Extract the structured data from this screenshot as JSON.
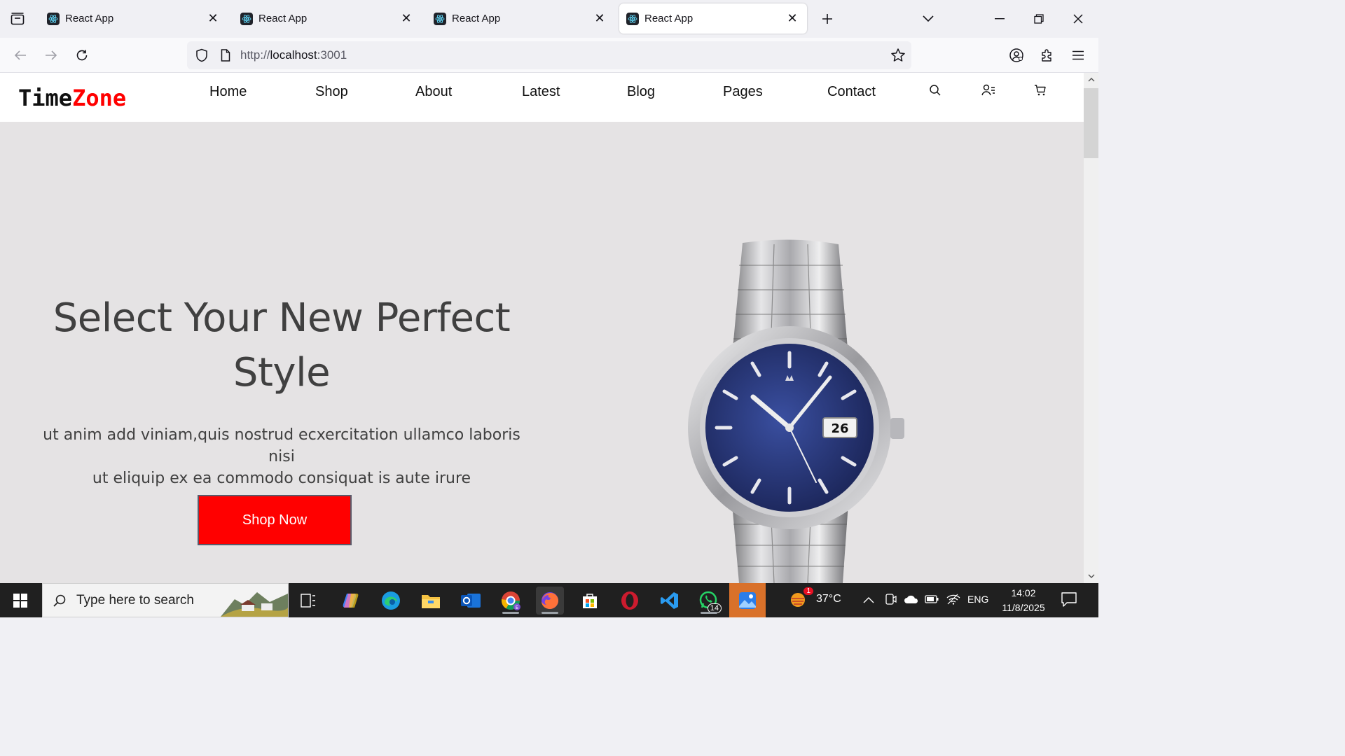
{
  "browser": {
    "tabs": [
      {
        "title": "React App",
        "active": false
      },
      {
        "title": "React App",
        "active": false
      },
      {
        "title": "React App",
        "active": false
      },
      {
        "title": "React App",
        "active": true
      }
    ],
    "url_prefix": "http://",
    "url_host": "localhost",
    "url_suffix": ":3001"
  },
  "site": {
    "logo_part1": "Time",
    "logo_part2": "Zone",
    "menu": [
      "Home",
      "Shop",
      "About",
      "Latest",
      "Blog",
      "Pages",
      "Contact"
    ],
    "header_icons": [
      "search-icon",
      "user-icon",
      "cart-icon"
    ]
  },
  "hero": {
    "title_line1": "Select Your New Perfect",
    "title_line2": "Style",
    "text_line1": "ut anim add viniam,quis nostrud ecxercitation ullamco laboris nisi",
    "text_line2": "ut eliquip ex ea commodo consiquat is aute irure",
    "button_label": "Shop Now",
    "image": "rolex-datejust-blue-dial-watch"
  },
  "taskbar": {
    "search_placeholder": "Type here to search",
    "weather_temp": "37°C",
    "weather_badge": "1",
    "whatsapp_badge": "14",
    "language": "ENG",
    "time": "14:02",
    "date": "11/8/2025"
  },
  "colors": {
    "accent_red": "#ff0000",
    "hero_bg": "#e5e3e4",
    "taskbar_bg": "#202020"
  }
}
